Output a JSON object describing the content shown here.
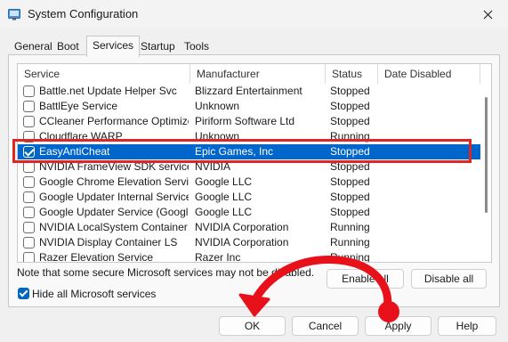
{
  "window": {
    "title": "System Configuration",
    "icon": "msconfig-icon"
  },
  "tabs": [
    {
      "label": "General"
    },
    {
      "label": "Boot"
    },
    {
      "label": "Services"
    },
    {
      "label": "Startup"
    },
    {
      "label": "Tools"
    }
  ],
  "active_tab": "Services",
  "columns": {
    "service": "Service",
    "manufacturer": "Manufacturer",
    "status": "Status",
    "date_disabled": "Date Disabled"
  },
  "services": [
    {
      "name": "Battle.net Update Helper Svc",
      "manufacturer": "Blizzard Entertainment",
      "status": "Stopped",
      "checked": false
    },
    {
      "name": "BattlEye Service",
      "manufacturer": "Unknown",
      "status": "Stopped",
      "checked": false
    },
    {
      "name": "CCleaner Performance Optimizer...",
      "manufacturer": "Piriform Software Ltd",
      "status": "Stopped",
      "checked": false
    },
    {
      "name": "Cloudflare WARP",
      "manufacturer": "Unknown",
      "status": "Running",
      "checked": false
    },
    {
      "name": "EasyAntiCheat",
      "manufacturer": "Epic Games, Inc",
      "status": "Stopped",
      "checked": true,
      "selected": true
    },
    {
      "name": "NVIDIA FrameView SDK service",
      "manufacturer": "NVIDIA",
      "status": "Stopped",
      "checked": false
    },
    {
      "name": "Google Chrome Elevation Servic...",
      "manufacturer": "Google LLC",
      "status": "Stopped",
      "checked": false
    },
    {
      "name": "Google Updater Internal Service...",
      "manufacturer": "Google LLC",
      "status": "Stopped",
      "checked": false
    },
    {
      "name": "Google Updater Service (Google...",
      "manufacturer": "Google LLC",
      "status": "Stopped",
      "checked": false
    },
    {
      "name": "NVIDIA LocalSystem Container",
      "manufacturer": "NVIDIA Corporation",
      "status": "Running",
      "checked": false
    },
    {
      "name": "NVIDIA Display Container LS",
      "manufacturer": "NVIDIA Corporation",
      "status": "Running",
      "checked": false
    },
    {
      "name": "Razer Elevation Service",
      "manufacturer": "Razer Inc",
      "status": "Running",
      "checked": false
    }
  ],
  "note": "Note that some secure Microsoft services may not be disabled.",
  "buttons": {
    "enable_all": "Enable all",
    "disable_all": "Disable all",
    "ok": "OK",
    "cancel": "Cancel",
    "apply": "Apply",
    "help": "Help"
  },
  "hide_ms": {
    "label": "Hide all Microsoft services",
    "checked": true
  },
  "colors": {
    "selection": "#0066cc",
    "highlight_box": "#e02525",
    "arrow": "#e8111a"
  }
}
